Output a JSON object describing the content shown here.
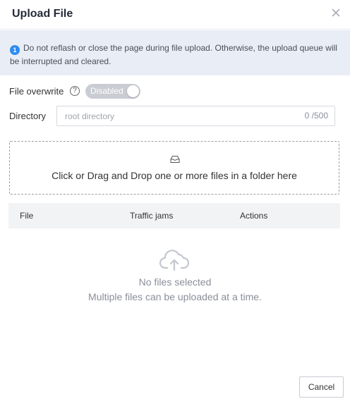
{
  "dialog": {
    "title": "Upload File",
    "close_icon": "close-icon"
  },
  "notice": {
    "icon_text": "1",
    "text": "Do not reflash or close the page during file upload. Otherwise, the upload queue will be interrupted and cleared."
  },
  "overwrite": {
    "label": "File overwrite",
    "help_icon": "?",
    "toggle_label": "Disabled",
    "enabled": false
  },
  "directory": {
    "label": "Directory",
    "value": "",
    "placeholder": "root directory",
    "counter": "0 /500"
  },
  "dropzone": {
    "icon": "inbox-icon",
    "text": "Click or Drag and Drop one or more files in a folder here"
  },
  "table": {
    "columns": [
      "File",
      "Traffic jams",
      "Actions"
    ]
  },
  "empty": {
    "icon": "cloud-upload-icon",
    "title": "No files selected",
    "subtitle": "Multiple files can be uploaded at a time."
  },
  "footer": {
    "cancel_label": "Cancel"
  },
  "colors": {
    "notice_bg": "#e8edf6",
    "info_blue": "#2d8cf0",
    "toggle_off": "#c9ccd3",
    "table_header_bg": "#f2f3f5"
  }
}
